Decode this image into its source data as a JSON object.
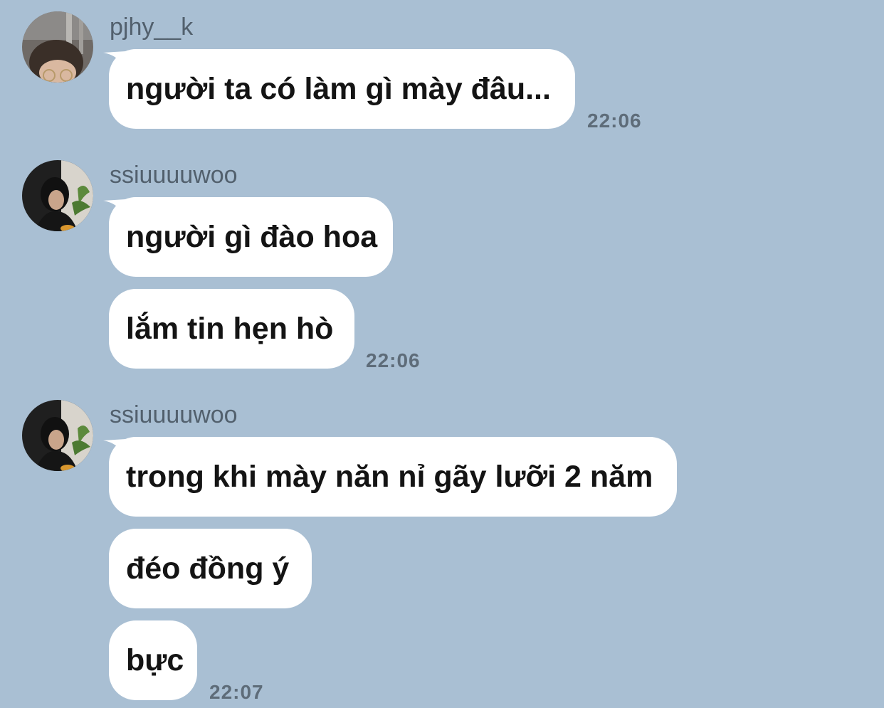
{
  "groups": [
    {
      "sender": "pjhy__k",
      "messages": [
        "người ta có làm gì mày đâu..."
      ],
      "time": "22:06"
    },
    {
      "sender": "ssiuuuuwoo",
      "messages": [
        "người gì đào hoa",
        "lắm tin hẹn hò"
      ],
      "time": "22:06"
    },
    {
      "sender": "ssiuuuuwoo",
      "messages": [
        "trong khi mày năn nỉ gãy lưỡi 2 năm",
        "đéo đồng ý",
        "bực"
      ],
      "time": "22:07"
    }
  ],
  "colors": {
    "background": "#a9bfd3",
    "bubble": "#ffffff",
    "sender_name": "#52606d",
    "timestamp": "#5e6c79",
    "message_text": "#141414"
  }
}
